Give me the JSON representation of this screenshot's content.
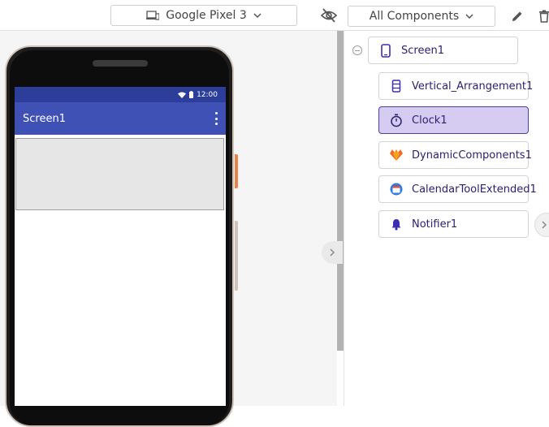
{
  "toolbar": {
    "device_label": "Google Pixel 3",
    "filter_label": "All Components"
  },
  "phone": {
    "status_time": "12:00",
    "screen_title": "Screen1"
  },
  "tree": {
    "root": {
      "label": "Screen1",
      "icon": "phone-icon"
    },
    "children": [
      {
        "label": "Vertical_Arrangement1",
        "icon": "vertical-arrangement-icon",
        "selected": false
      },
      {
        "label": "Clock1",
        "icon": "timer-icon",
        "selected": true
      },
      {
        "label": "DynamicComponents1",
        "icon": "dynamic-components-icon",
        "selected": false
      },
      {
        "label": "CalendarToolExtended1",
        "icon": "calendar-icon",
        "selected": false
      },
      {
        "label": "Notifier1",
        "icon": "bell-icon",
        "selected": false
      }
    ]
  },
  "colors": {
    "accent": "#3f51b5",
    "status_bar": "#2c3e99",
    "selected_bg": "#d6cbf1",
    "selected_border": "#4e3ca3",
    "label_text": "#2b2170"
  }
}
